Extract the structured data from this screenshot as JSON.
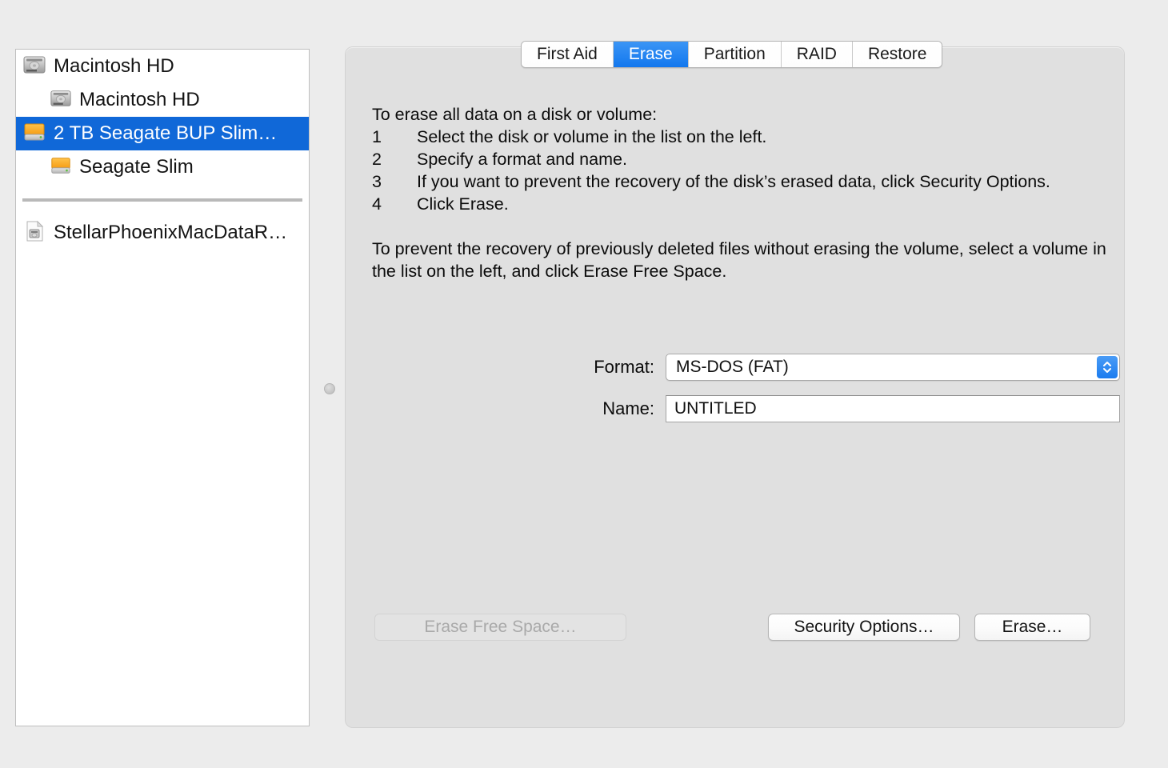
{
  "window": {
    "app": "Disk Utility",
    "background_color": "#ececec",
    "accent_color": "#1068d8"
  },
  "sidebar": {
    "items": [
      {
        "label": "Macintosh HD",
        "icon": "internal-hard-drive-icon",
        "level": 0,
        "selected": false
      },
      {
        "label": "Macintosh HD",
        "icon": "internal-hard-drive-icon",
        "level": 1,
        "selected": false
      },
      {
        "label": "2 TB Seagate BUP Slim…",
        "icon": "external-hard-drive-icon",
        "level": 0,
        "selected": true
      },
      {
        "label": "Seagate Slim",
        "icon": "external-hard-drive-icon",
        "level": 1,
        "selected": false
      }
    ],
    "separator": true,
    "images": [
      {
        "label": "StellarPhoenixMacDataR…",
        "icon": "disk-image-document-icon",
        "level": 0,
        "selected": false
      }
    ]
  },
  "splitter": {
    "handle": "resize-dot"
  },
  "tabs": [
    {
      "label": "First Aid",
      "active": false
    },
    {
      "label": "Erase",
      "active": true
    },
    {
      "label": "Partition",
      "active": false
    },
    {
      "label": "RAID",
      "active": false
    },
    {
      "label": "Restore",
      "active": false
    }
  ],
  "instructions": {
    "intro": "To erase all data on a disk or volume:",
    "steps": [
      {
        "num": "1",
        "text": "Select the disk or volume in the list on the left."
      },
      {
        "num": "2",
        "text": "Specify a format and name."
      },
      {
        "num": "3",
        "text": "If you want to prevent the recovery of the disk’s erased data, click Security Options."
      },
      {
        "num": "4",
        "text": "Click Erase."
      }
    ],
    "note": "To prevent the recovery of previously deleted files without erasing the volume, select a volume in the list on the left, and click Erase Free Space."
  },
  "form": {
    "format_label": "Format:",
    "format_value": "MS-DOS (FAT)",
    "name_label": "Name:",
    "name_value": "UNTITLED"
  },
  "buttons": {
    "erase_free_space": "Erase Free Space…",
    "security_options": "Security Options…",
    "erase": "Erase…"
  }
}
